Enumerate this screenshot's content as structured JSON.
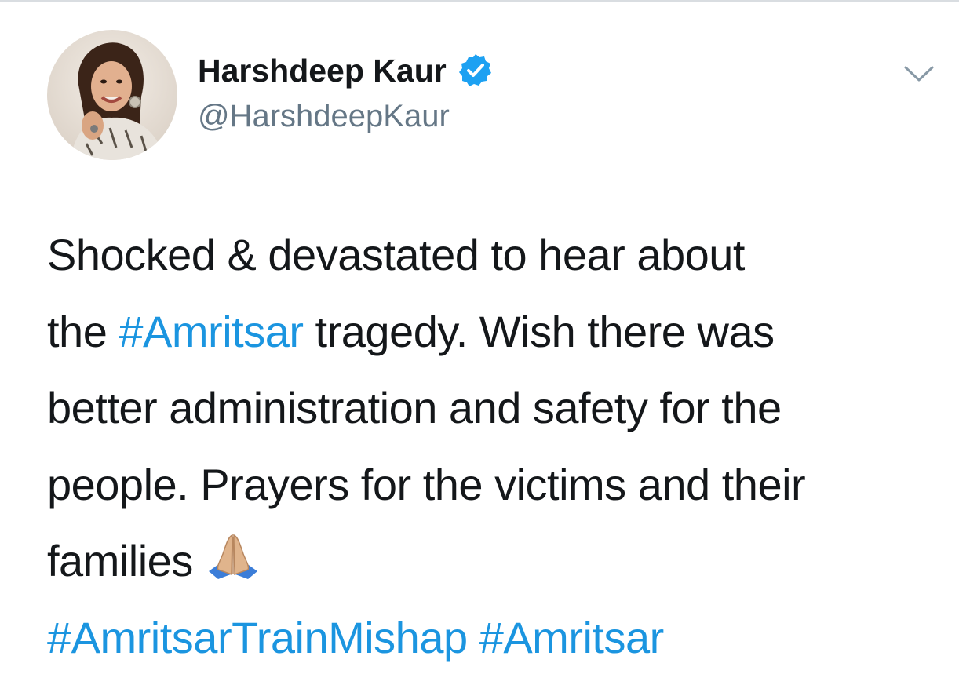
{
  "author": {
    "name": "Harshdeep Kaur",
    "handle": "@HarshdeepKaur",
    "verified": true,
    "avatar_icon": "profile-photo"
  },
  "menu": {
    "icon": "chevron-down-icon"
  },
  "tweet": {
    "line1": "Shocked & devastated to hear about",
    "line2_pre": "the ",
    "line2_tag": "#Amritsar",
    "line2_post": " tragedy. Wish there was",
    "line3": "better administration and safety for the",
    "line4": "people. Prayers for the victims and their",
    "line5": "families",
    "emoji": "folded-hands-emoji",
    "tag1": "#AmritsarTrainMishap",
    "tag_sep": " ",
    "tag2": "#Amritsar"
  },
  "colors": {
    "text": "#14171a",
    "secondary": "#657786",
    "link": "#1b95e0",
    "verified": "#1da1f2"
  }
}
